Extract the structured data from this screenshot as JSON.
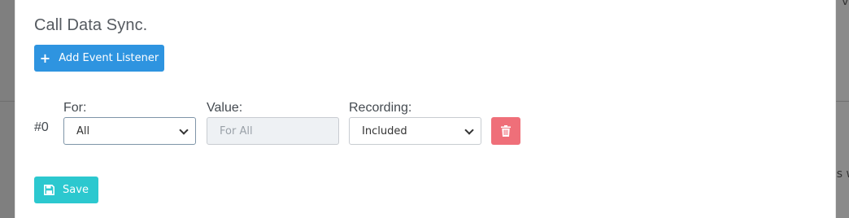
{
  "modal": {
    "title": "Call Data Sync.",
    "add_button_label": "Add Event Listener",
    "save_button_label": "Save"
  },
  "listener_row": {
    "index_label": "#0",
    "for_label": "For:",
    "for_selected": "All",
    "value_label": "Value:",
    "value_placeholder": "For All",
    "recording_label": "Recording:",
    "recording_selected": "Included"
  },
  "backdrop": {
    "fragment_top": "ve",
    "fragment_mid": "s w"
  },
  "icons": {
    "add": "plus-icon",
    "delete": "trash-icon",
    "save": "floppy-disk-icon",
    "select": "chevron-down-icon"
  },
  "colors": {
    "primary": "#2e94e0",
    "danger": "#ef6f79",
    "info": "#2cc8cf"
  }
}
